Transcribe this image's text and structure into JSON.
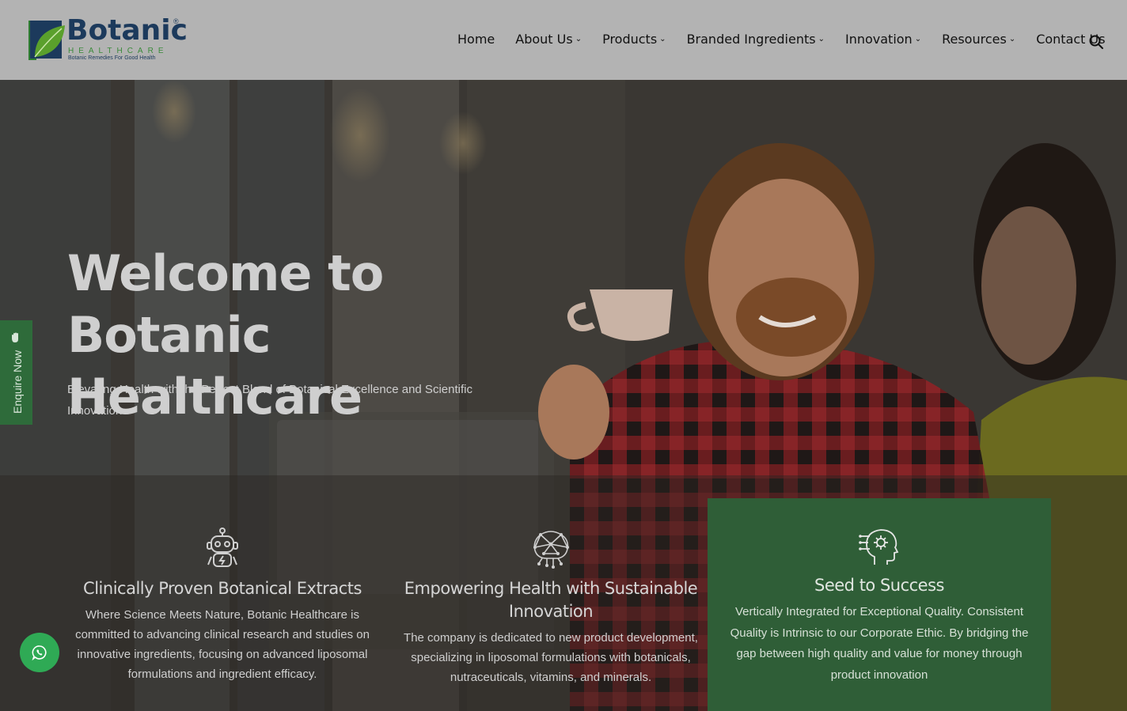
{
  "brand": {
    "name": "Botanic",
    "registered": "®",
    "subtitle": "HEALTHCARE",
    "tagline": "Botanic Remedies For Good Health"
  },
  "nav": {
    "items": [
      {
        "label": "Home",
        "dropdown": false
      },
      {
        "label": "About Us",
        "dropdown": true
      },
      {
        "label": "Products",
        "dropdown": true
      },
      {
        "label": "Branded Ingredients",
        "dropdown": true
      },
      {
        "label": "Innovation",
        "dropdown": true
      },
      {
        "label": "Resources",
        "dropdown": true
      },
      {
        "label": "Contact Us",
        "dropdown": false
      }
    ],
    "search_icon": "search-icon"
  },
  "hero": {
    "title_line1": "Welcome to",
    "title_line2": "Botanic Healthcare",
    "subtitle": "Elevating Health with the Perfect Blend of Botanical Excellence and Scientific Innovation"
  },
  "enquire": {
    "label": "Enquire Now",
    "icon": "hand-icon"
  },
  "features": [
    {
      "icon": "robot-icon",
      "title": "Clinically Proven Botanical Extracts",
      "description": "Where Science Meets Nature, Botanic Healthcare is committed to advancing clinical research and studies on innovative ingredients, focusing on advanced liposomal formulations and ingredient efficacy."
    },
    {
      "icon": "brain-network-icon",
      "title": "Empowering Health with Sustainable Innovation",
      "description": "The company is dedicated to new product development, specializing in liposomal formulations with botanicals, nutraceuticals, vitamins, and minerals."
    },
    {
      "icon": "head-circuit-icon",
      "title": "Seed to Success",
      "description": "Vertically Integrated for Exceptional Quality. Consistent Quality is Intrinsic to our Corporate Ethic. By bridging the gap between high quality and value for money through product innovation"
    }
  ],
  "whatsapp": {
    "icon": "whatsapp-icon"
  },
  "colors": {
    "header_bg": "#b3b3b3",
    "brand_navy": "#1c3a5c",
    "brand_green": "#2f5e37",
    "whatsapp_green": "#2faa55"
  }
}
